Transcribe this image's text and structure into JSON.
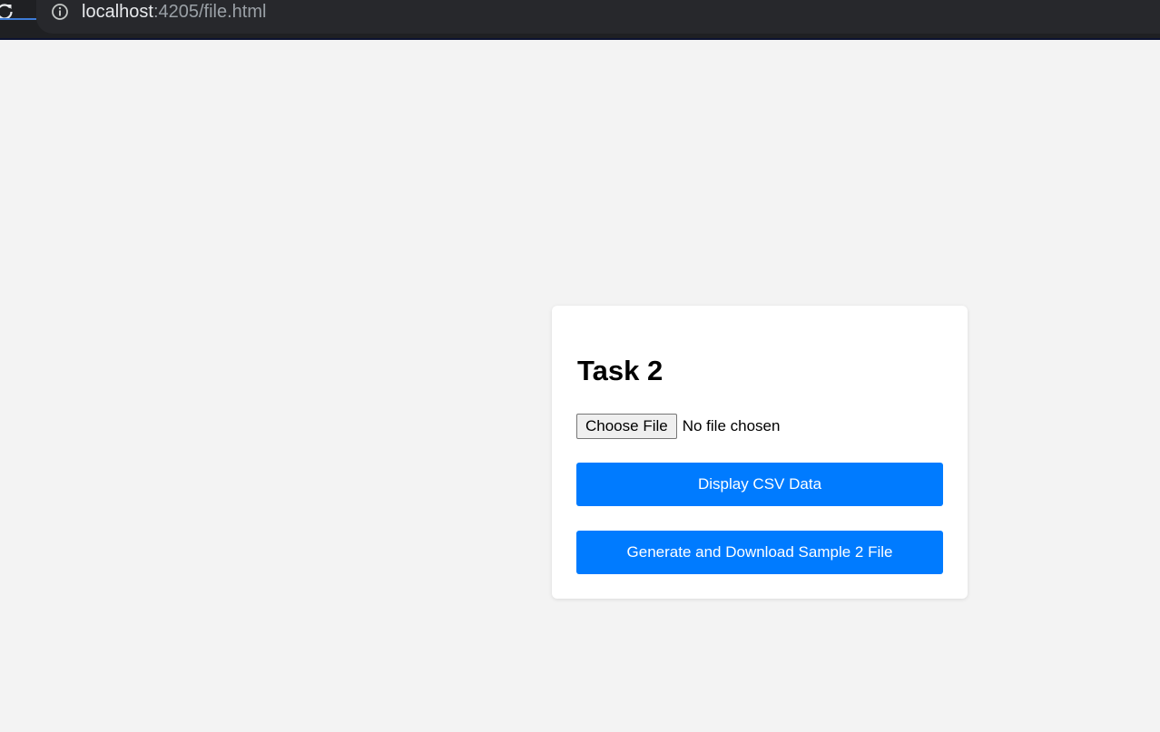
{
  "browser": {
    "url_host": "localhost",
    "url_rest": ":4205/file.html",
    "icons": {
      "reload": "reload-icon",
      "info": "info-icon"
    }
  },
  "card": {
    "title": "Task 2",
    "file_input": {
      "button_label": "Choose File",
      "status_text": "No file chosen"
    },
    "buttons": {
      "display_label": "Display CSV Data",
      "generate_label": "Generate and Download Sample 2 File"
    }
  },
  "colors": {
    "primary": "#007bff",
    "page_background": "#f3f3f3",
    "card_background": "#ffffff",
    "browser_bar": "#1f2023"
  }
}
